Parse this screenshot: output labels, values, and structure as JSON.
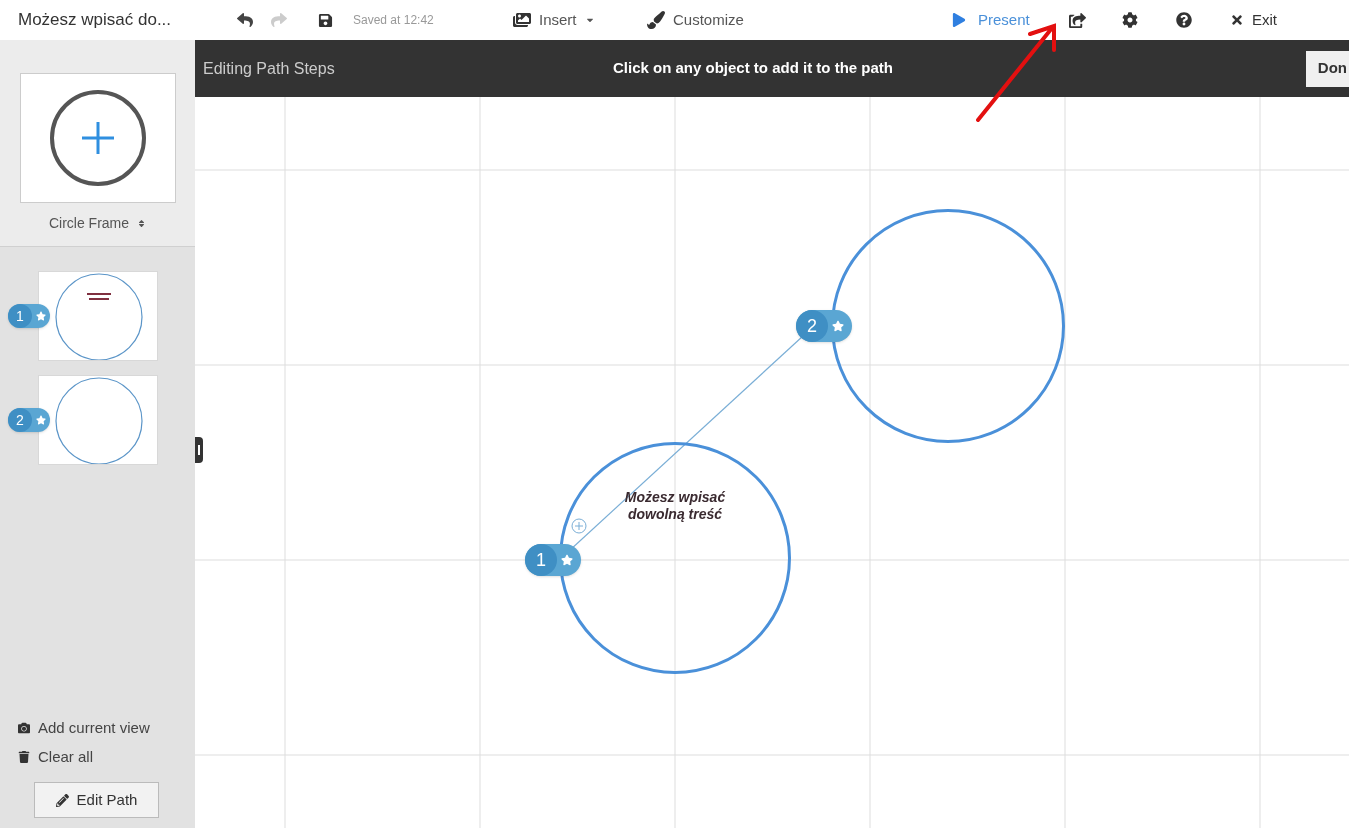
{
  "document_title": "Możesz wpisać do...",
  "history": [
    {
      "kind": "undo",
      "disabled": false
    },
    {
      "kind": "redo",
      "disabled": true
    }
  ],
  "save_status": "Saved at 12:42",
  "menu": [
    {
      "kind": "insert",
      "label": "Insert"
    },
    {
      "kind": "customize",
      "label": "Customize"
    }
  ],
  "present_button": "Present",
  "exit_button": "Exit",
  "path_bar": {
    "title": "Editing Path Steps",
    "instruction": "Click on any object to add it to the path",
    "done_button": "Don"
  },
  "sidebar": {
    "frame_picker": "Circle Frame",
    "steps": [
      {
        "number": "1",
        "has_text": true
      },
      {
        "number": "2",
        "has_text": false
      }
    ],
    "actions": [
      {
        "kind": "camera",
        "label": "Add current view"
      },
      {
        "kind": "trash",
        "label": "Clear all"
      }
    ],
    "edit_path_button": "Edit Path"
  },
  "canvas": {
    "frames": [
      {
        "number": "1",
        "text": "Możesz wpisać dowolną treść"
      },
      {
        "number": "2"
      }
    ]
  }
}
